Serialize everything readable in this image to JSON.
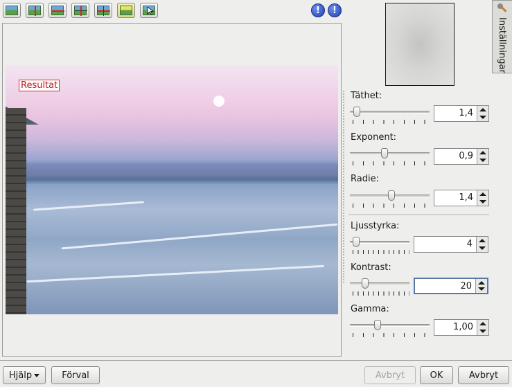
{
  "toolbar": {
    "icons": [
      "original-image-icon",
      "split-vertical-icon",
      "split-horizontal-icon",
      "split-vertical-duplicate-icon",
      "split-horizontal-duplicate-icon",
      "result-only-icon",
      "compare-cursor-icon"
    ],
    "info_icons": [
      "under-exposure-warning-icon",
      "over-exposure-warning-icon"
    ]
  },
  "preview": {
    "overlay_label": "Resultat"
  },
  "side_tab": {
    "label": "Inställningar"
  },
  "params": {
    "density": {
      "label": "Täthet:",
      "value": "1,4",
      "level": 0.05
    },
    "exponent": {
      "label": "Exponent:",
      "value": "0,9",
      "level": 0.43
    },
    "radius": {
      "label": "Radie:",
      "value": "1,4",
      "level": 0.52
    },
    "brightness": {
      "label": "Ljusstyrka:",
      "value": "4",
      "level": 0.05
    },
    "contrast": {
      "label": "Kontrast:",
      "value": "20",
      "level": 0.22
    },
    "gamma": {
      "label": "Gamma:",
      "value": "1,00",
      "level": 0.33
    }
  },
  "buttons": {
    "help": "Hjälp",
    "defaults": "Förval",
    "cancel_disabled": "Avbryt",
    "ok": "OK",
    "cancel": "Avbryt"
  },
  "colors": {
    "accent_red": "#d03030",
    "focus_blue": "#5577aa"
  }
}
